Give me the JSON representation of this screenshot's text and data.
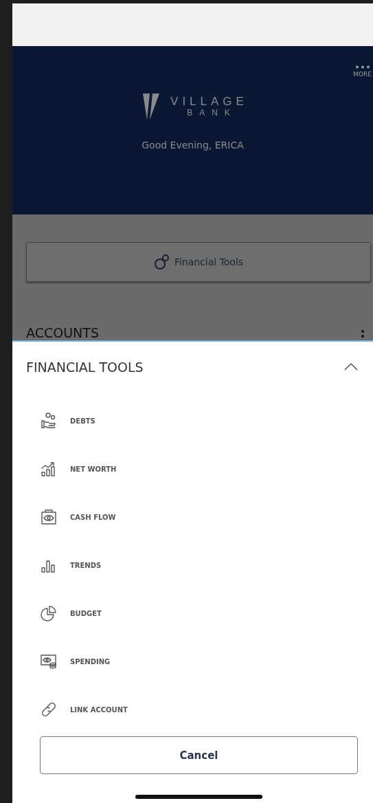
{
  "header": {
    "more_label": "MORE",
    "logo_top": "VILLAGE",
    "logo_bottom": "BANK",
    "greeting": "Good Evening, ERICA"
  },
  "financial_tools_button": {
    "label": "Financial Tools"
  },
  "accounts": {
    "title": "ACCOUNTS"
  },
  "sheet": {
    "title": "FINANCIAL TOOLS",
    "expanded": true,
    "items": [
      {
        "label": "DEBTS"
      },
      {
        "label": "NET WORTH"
      },
      {
        "label": "CASH FLOW"
      },
      {
        "label": "TRENDS"
      },
      {
        "label": "BUDGET"
      },
      {
        "label": "SPENDING"
      },
      {
        "label": "LINK ACCOUNT"
      }
    ],
    "cancel": "Cancel"
  }
}
